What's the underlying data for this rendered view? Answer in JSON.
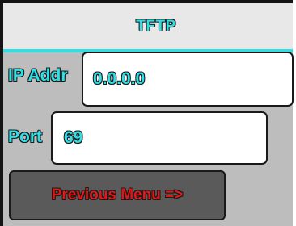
{
  "title": "TFTP",
  "fields": {
    "ip": {
      "label": "IP Addr",
      "value": "0.0.0.0"
    },
    "port": {
      "label": "Port",
      "value": "69"
    }
  },
  "buttons": {
    "previous_menu": "Previous Menu =>"
  },
  "colors": {
    "accent": "#2ee0e6",
    "button_text": "#e01818",
    "background": "#bdbdbd",
    "title_bar": "#e8e8e8",
    "button_bg": "#5a5a5a"
  }
}
